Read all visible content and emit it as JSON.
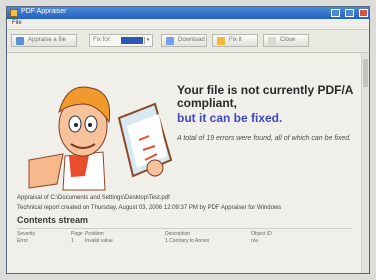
{
  "window": {
    "title": "PDF Appraiser"
  },
  "menu": {
    "file": "File"
  },
  "toolbar": {
    "buttons": [
      "Appraise a file",
      "Appraise",
      "Download",
      "Fix it",
      "Close"
    ],
    "select_label": "Fix for:"
  },
  "content": {
    "headline": "Your file is not currently PDF/A compliant,",
    "subheadline": "but it can be fixed.",
    "summary": "A total of 19 errors were found, all of which can be fixed.",
    "appraisal_line": "Appraisal of C:\\Documents and Settings\\Desktop\\Test.pdf",
    "report_line": "Technical report created on Thursday, August 03, 2006 12:09:37 PM by PDF Appraiser for Windows",
    "section_title": "Contents stream"
  },
  "table": {
    "headers": [
      "Severity",
      "Page",
      "Problem",
      "Description",
      "Object ID"
    ],
    "row": [
      "Error",
      "1",
      "Invalid value",
      "1 Contrary to Annex",
      "n/a"
    ]
  },
  "colors": {
    "titlebar": "#2561c2",
    "accent": "#3e49c8",
    "background": "#f0efe9"
  },
  "icons": [
    "app-icon",
    "minimize-icon",
    "maximize-icon",
    "close-icon",
    "file-icon",
    "download-icon",
    "fix-icon",
    "help-icon"
  ]
}
